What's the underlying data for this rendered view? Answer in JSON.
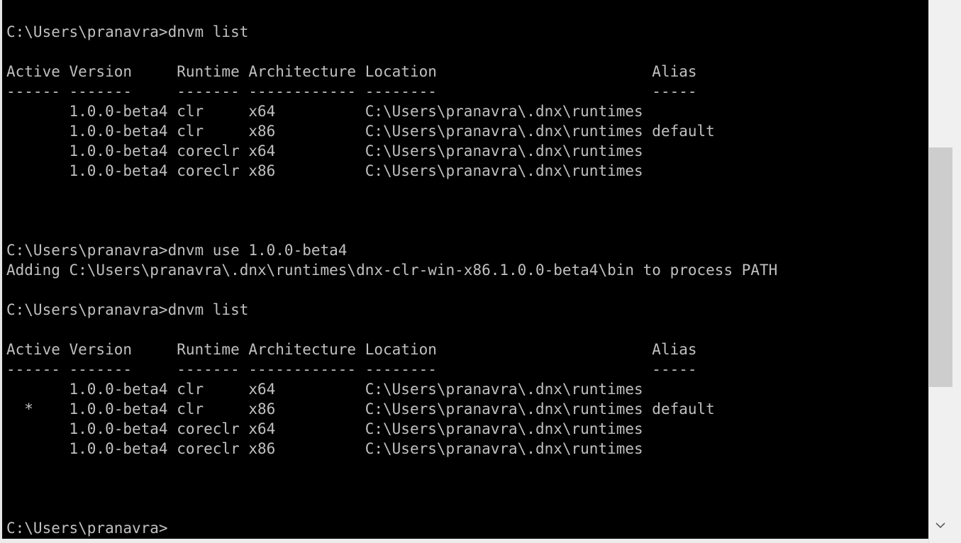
{
  "console": {
    "lines": [
      "C:\\Users\\pranavra>dnvm list",
      "",
      "Active Version     Runtime Architecture Location                        Alias",
      "------ -------     ------- ------------ --------                        -----",
      "       1.0.0-beta4 clr     x64          C:\\Users\\pranavra\\.dnx\\runtimes",
      "       1.0.0-beta4 clr     x86          C:\\Users\\pranavra\\.dnx\\runtimes default",
      "       1.0.0-beta4 coreclr x64          C:\\Users\\pranavra\\.dnx\\runtimes",
      "       1.0.0-beta4 coreclr x86          C:\\Users\\pranavra\\.dnx\\runtimes",
      "",
      "",
      "",
      "C:\\Users\\pranavra>dnvm use 1.0.0-beta4",
      "Adding C:\\Users\\pranavra\\.dnx\\runtimes\\dnx-clr-win-x86.1.0.0-beta4\\bin to process PATH",
      "",
      "C:\\Users\\pranavra>dnvm list",
      "",
      "Active Version     Runtime Architecture Location                        Alias",
      "------ -------     ------- ------------ --------                        -----",
      "       1.0.0-beta4 clr     x64          C:\\Users\\pranavra\\.dnx\\runtimes",
      "  *    1.0.0-beta4 clr     x86          C:\\Users\\pranavra\\.dnx\\runtimes default",
      "       1.0.0-beta4 coreclr x64          C:\\Users\\pranavra\\.dnx\\runtimes",
      "       1.0.0-beta4 coreclr x86          C:\\Users\\pranavra\\.dnx\\runtimes",
      "",
      "",
      "",
      "C:\\Users\\pranavra>"
    ]
  },
  "colors": {
    "background": "#000000",
    "foreground": "#c0c0c0",
    "scrollbar_track": "#f0f0f0",
    "scrollbar_thumb": "#cdcdcd"
  },
  "scrollbar": {
    "down_arrow_icon": "chevron-down-icon"
  }
}
